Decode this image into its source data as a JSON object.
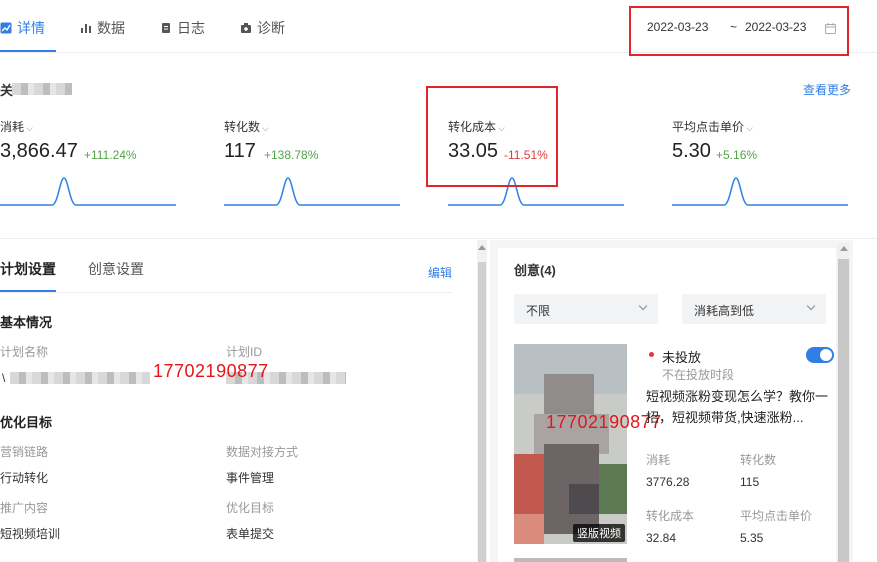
{
  "tabs": [
    {
      "label": "详情",
      "icon": "trend-chart-icon",
      "active": true
    },
    {
      "label": "数据",
      "icon": "bar-chart-icon",
      "active": false
    },
    {
      "label": "日志",
      "icon": "log-icon",
      "active": false
    },
    {
      "label": "诊断",
      "icon": "diagnose-icon",
      "active": false
    }
  ],
  "date_range": {
    "start": "2022-03-23",
    "separator": "~",
    "end": "2022-03-23",
    "icon": "calendar-icon"
  },
  "metrics_section": {
    "title": "关",
    "more": "查看更多"
  },
  "metrics": [
    {
      "label": "消耗",
      "value": "3,866.47",
      "change": "+111.24%",
      "trend": "up"
    },
    {
      "label": "转化数",
      "value": "117",
      "change": "+138.78%",
      "trend": "up"
    },
    {
      "label": "转化成本",
      "value": "33.05",
      "change": "-11.51%",
      "trend": "down"
    },
    {
      "label": "平均点击单价",
      "value": "5.30",
      "change": "+5.16%",
      "trend": "up"
    }
  ],
  "plan": {
    "tabs": [
      "计划设置",
      "创意设置"
    ],
    "edit": "编辑",
    "basic": {
      "title": "基本情况",
      "name_label": "计划名称",
      "name_prefix": "\\",
      "id_label": "计划ID"
    },
    "phone_overlay": "17702190877",
    "optimize": {
      "title": "优化目标",
      "fields": [
        {
          "label": "营销链路",
          "value": "行动转化"
        },
        {
          "label": "数据对接方式",
          "value": "事件管理"
        },
        {
          "label": "推广内容",
          "value": "短视频培训"
        },
        {
          "label": "优化目标",
          "value": "表单提交"
        }
      ]
    }
  },
  "creative": {
    "title": "创意(4)",
    "filter_select": "不限",
    "sort_select": "消耗高到低",
    "status": "未投放",
    "status_sub": "不在投放时段",
    "toggle_on": true,
    "description": "短视频涨粉变现怎么学？教你一招，短视频带货,快速涨粉...",
    "thumb_tag": "竖版视频",
    "phone_overlay": "17702190877",
    "stats": [
      {
        "label": "消耗",
        "value": "3776.28"
      },
      {
        "label": "转化数",
        "value": "115"
      },
      {
        "label": "转化成本",
        "value": "32.84"
      },
      {
        "label": "平均点击单价",
        "value": "5.35"
      }
    ]
  },
  "colors": {
    "accent": "#2f7fe6",
    "up": "#52a348",
    "down": "#e23a3a",
    "highlight_box": "#e0262a",
    "overlay_text": "#e4161b"
  }
}
